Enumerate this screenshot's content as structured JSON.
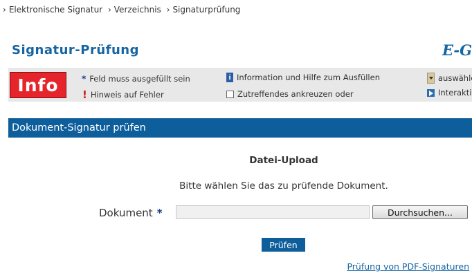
{
  "breadcrumb": {
    "items": [
      "Elektronische Signatur",
      "Verzeichnis",
      "Signaturprüfung"
    ],
    "separator": "›"
  },
  "page": {
    "title": "Signatur-Prüfung",
    "brand": "E-G"
  },
  "legend": {
    "info_button": "Info",
    "required": "Feld muss ausgefüllt sein",
    "error": "Hinweis auf Fehler",
    "help": "Information und Hilfe zum Ausfüllen",
    "checkbox": "Zutreffendes ankreuzen oder",
    "select": "auswählen",
    "interactive": "Interaktiv"
  },
  "section": {
    "title": "Dokument-Signatur prüfen"
  },
  "upload": {
    "heading": "Datei-Upload",
    "hint": "Bitte wählen Sie das zu prüfende Dokument.",
    "field_label": "Dokument",
    "required_mark": "*",
    "file_value": "",
    "browse_label": "Durchsuchen...",
    "submit_label": "Prüfen",
    "pdf_link": "Prüfung von PDF-Signaturen"
  },
  "colors": {
    "accent": "#0e5e9c",
    "info_red": "#e6242b",
    "infobar_bg": "#e8e8e8"
  }
}
